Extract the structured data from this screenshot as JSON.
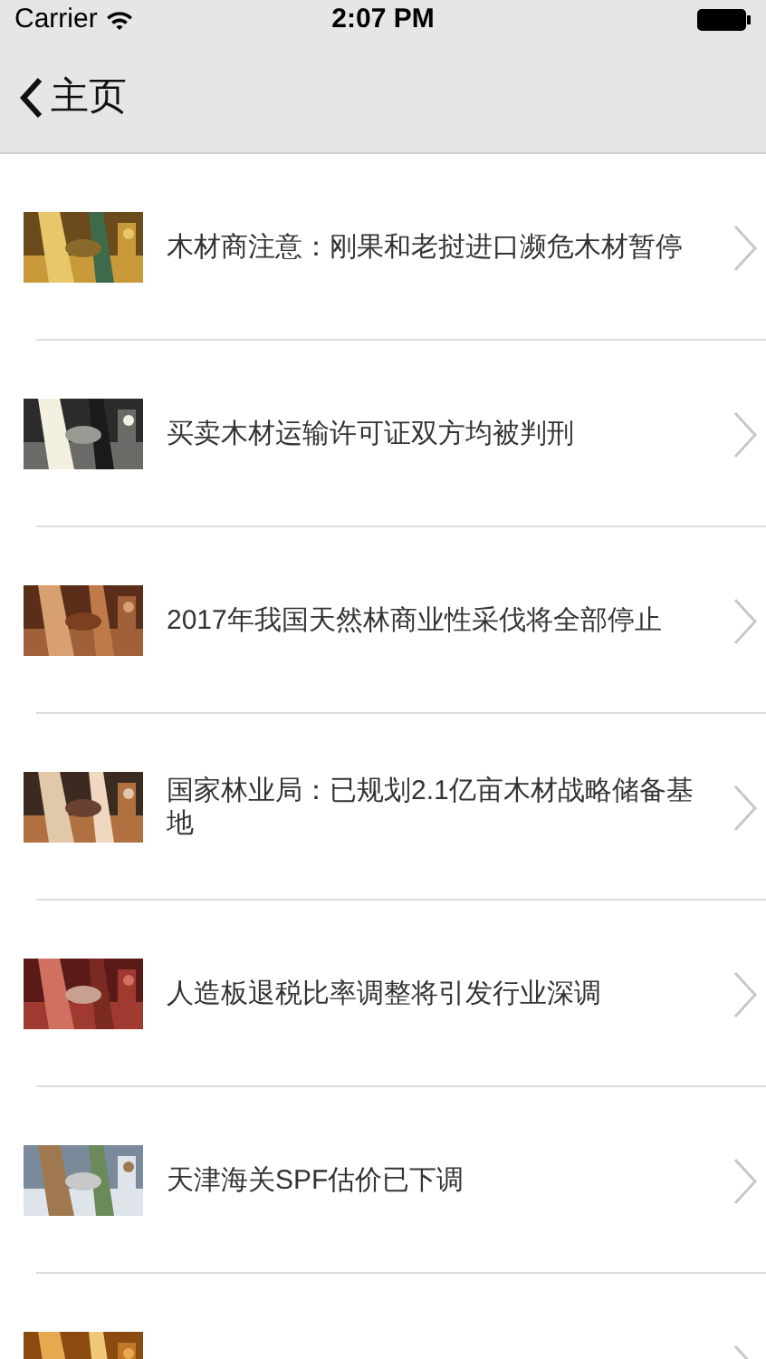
{
  "status_bar": {
    "carrier": "Carrier",
    "time": "2:07 PM"
  },
  "nav": {
    "back_label": "主页"
  },
  "articles": [
    {
      "title": "木材商注意：刚果和老挝进口濒危木材暂停",
      "thumbnail": {
        "kind": "picture"
      }
    },
    {
      "title": "买卖木材运输许可证双方均被判刑",
      "thumbnail": {
        "kind": "picture"
      }
    },
    {
      "title": "2017年我国天然林商业性采伐将全部停止",
      "thumbnail": {
        "kind": "picture"
      }
    },
    {
      "title": "国家林业局：已规划2.1亿亩木材战略储备基地",
      "thumbnail": {
        "kind": "picture"
      }
    },
    {
      "title": "人造板退税比率调整将引发行业深调",
      "thumbnail": {
        "kind": "picture"
      }
    },
    {
      "title": "天津海关SPF估价已下调",
      "thumbnail": {
        "kind": "picture"
      }
    },
    {
      "thumbnail": {
        "kind": "picture"
      }
    }
  ]
}
